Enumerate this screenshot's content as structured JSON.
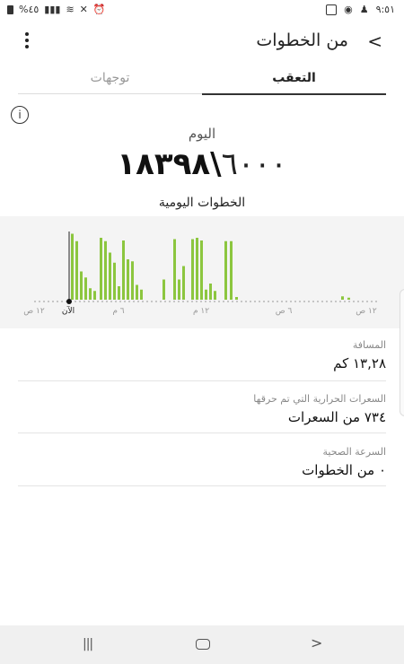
{
  "status_bar": {
    "battery": "%٤٥",
    "time": "٩:٥١"
  },
  "header": {
    "title": "من الخطوات"
  },
  "tabs": [
    {
      "label": "التعقب",
      "active": true
    },
    {
      "label": "توجهات",
      "active": false
    }
  ],
  "summary": {
    "today_label": "اليوم",
    "steps": "١٨٣٩٨",
    "separator": "\\",
    "goal": "٦٠٠٠",
    "caption": "الخطوات اليومية"
  },
  "chart_data": {
    "type": "bar",
    "series_color": "#8cc63f",
    "x_labels": [
      "١٢ ص",
      "٦ ص",
      "١٢ م",
      "٦ م",
      "الآن",
      "١٢ ص"
    ],
    "bars": [
      0.98,
      0.87,
      0.42,
      0.33,
      0.17,
      0.13,
      0.92,
      0.87,
      0.7,
      0.55,
      0.2,
      0.88,
      0.6,
      0.57,
      0.22,
      0.15,
      0.3,
      0.9,
      0.3,
      0.5,
      0.9,
      0.92,
      0.88,
      0.15,
      0.24,
      0.13,
      0.87,
      0.87,
      0.04,
      0.05,
      0.03
    ]
  },
  "details": [
    {
      "label": "المسافة",
      "value": "١٣,٢٨ كم"
    },
    {
      "label": "السعرات الحرارية التي تم حرقها",
      "value": "٧٣٤ من السعرات"
    },
    {
      "label": "السرعة الصحية",
      "value": "٠ من الخطوات"
    }
  ],
  "icons": {
    "back": "chevron-left-icon",
    "more": "more-vertical-icon",
    "info": "info-icon"
  }
}
